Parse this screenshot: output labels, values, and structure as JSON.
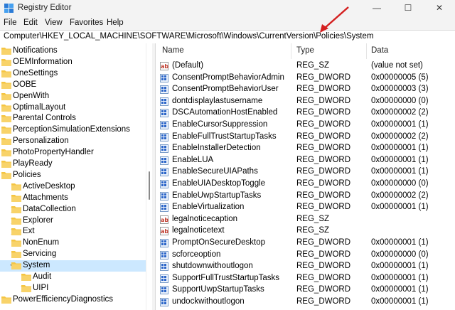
{
  "window": {
    "title": "Registry Editor",
    "minimize": "—",
    "maximize": "☐",
    "close": "✕"
  },
  "menu": [
    "File",
    "Edit",
    "View",
    "Favorites",
    "Help"
  ],
  "address": "Computer\\HKEY_LOCAL_MACHINE\\SOFTWARE\\Microsoft\\Windows\\CurrentVersion\\Policies\\System",
  "tree": [
    {
      "label": "Notifications",
      "chevron": false,
      "indent": 0
    },
    {
      "label": "OEMInformation",
      "chevron": false,
      "indent": 0
    },
    {
      "label": "OneSettings",
      "chevron": false,
      "indent": 0
    },
    {
      "label": "OOBE",
      "chevron": false,
      "indent": 0
    },
    {
      "label": "OpenWith",
      "chevron": false,
      "indent": 0
    },
    {
      "label": "OptimalLayout",
      "chevron": false,
      "indent": 0
    },
    {
      "label": "Parental Controls",
      "chevron": false,
      "indent": 0
    },
    {
      "label": "PerceptionSimulationExtensions",
      "chevron": false,
      "indent": 0
    },
    {
      "label": "Personalization",
      "chevron": false,
      "indent": 0
    },
    {
      "label": "PhotoPropertyHandler",
      "chevron": false,
      "indent": 0
    },
    {
      "label": "PlayReady",
      "chevron": false,
      "indent": 0
    },
    {
      "label": "Policies",
      "chevron": false,
      "indent": 0
    },
    {
      "label": "ActiveDesktop",
      "chevron": false,
      "indent": 1
    },
    {
      "label": "Attachments",
      "chevron": false,
      "indent": 1
    },
    {
      "label": "DataCollection",
      "chevron": true,
      "indent": 1
    },
    {
      "label": "Explorer",
      "chevron": true,
      "indent": 1
    },
    {
      "label": "Ext",
      "chevron": true,
      "indent": 1
    },
    {
      "label": "NonEnum",
      "chevron": false,
      "indent": 1
    },
    {
      "label": "Servicing",
      "chevron": false,
      "indent": 1
    },
    {
      "label": "System",
      "chevron": true,
      "expanded": true,
      "indent": 1,
      "selected": true
    },
    {
      "label": "Audit",
      "chevron": false,
      "indent": 2
    },
    {
      "label": "UIPI",
      "chevron": true,
      "indent": 2
    },
    {
      "label": "PowerEfficiencyDiagnostics",
      "chevron": false,
      "indent": 0
    }
  ],
  "columns": {
    "name": "Name",
    "type": "Type",
    "data": "Data"
  },
  "values": [
    {
      "name": "(Default)",
      "type": "REG_SZ",
      "data": "(value not set)",
      "icon": "string"
    },
    {
      "name": "ConsentPromptBehaviorAdmin",
      "type": "REG_DWORD",
      "data": "0x00000005 (5)",
      "icon": "binary"
    },
    {
      "name": "ConsentPromptBehaviorUser",
      "type": "REG_DWORD",
      "data": "0x00000003 (3)",
      "icon": "binary"
    },
    {
      "name": "dontdisplaylastusername",
      "type": "REG_DWORD",
      "data": "0x00000000 (0)",
      "icon": "binary"
    },
    {
      "name": "DSCAutomationHostEnabled",
      "type": "REG_DWORD",
      "data": "0x00000002 (2)",
      "icon": "binary"
    },
    {
      "name": "EnableCursorSuppression",
      "type": "REG_DWORD",
      "data": "0x00000001 (1)",
      "icon": "binary"
    },
    {
      "name": "EnableFullTrustStartupTasks",
      "type": "REG_DWORD",
      "data": "0x00000002 (2)",
      "icon": "binary"
    },
    {
      "name": "EnableInstallerDetection",
      "type": "REG_DWORD",
      "data": "0x00000001 (1)",
      "icon": "binary"
    },
    {
      "name": "EnableLUA",
      "type": "REG_DWORD",
      "data": "0x00000001 (1)",
      "icon": "binary"
    },
    {
      "name": "EnableSecureUIAPaths",
      "type": "REG_DWORD",
      "data": "0x00000001 (1)",
      "icon": "binary"
    },
    {
      "name": "EnableUIADesktopToggle",
      "type": "REG_DWORD",
      "data": "0x00000000 (0)",
      "icon": "binary"
    },
    {
      "name": "EnableUwpStartupTasks",
      "type": "REG_DWORD",
      "data": "0x00000002 (2)",
      "icon": "binary"
    },
    {
      "name": "EnableVirtualization",
      "type": "REG_DWORD",
      "data": "0x00000001 (1)",
      "icon": "binary"
    },
    {
      "name": "legalnoticecaption",
      "type": "REG_SZ",
      "data": "",
      "icon": "string"
    },
    {
      "name": "legalnoticetext",
      "type": "REG_SZ",
      "data": "",
      "icon": "string"
    },
    {
      "name": "PromptOnSecureDesktop",
      "type": "REG_DWORD",
      "data": "0x00000001 (1)",
      "icon": "binary"
    },
    {
      "name": "scforceoption",
      "type": "REG_DWORD",
      "data": "0x00000000 (0)",
      "icon": "binary"
    },
    {
      "name": "shutdownwithoutlogon",
      "type": "REG_DWORD",
      "data": "0x00000001 (1)",
      "icon": "binary"
    },
    {
      "name": "SupportFullTrustStartupTasks",
      "type": "REG_DWORD",
      "data": "0x00000001 (1)",
      "icon": "binary"
    },
    {
      "name": "SupportUwpStartupTasks",
      "type": "REG_DWORD",
      "data": "0x00000001 (1)",
      "icon": "binary"
    },
    {
      "name": "undockwithoutlogon",
      "type": "REG_DWORD",
      "data": "0x00000001 (1)",
      "icon": "binary"
    }
  ],
  "colors": {
    "selection": "#cce8ff",
    "folder": "#f5c542",
    "arrow": "#d42020",
    "string_icon": "#c0392b",
    "binary_icon": "#2b65c8"
  }
}
